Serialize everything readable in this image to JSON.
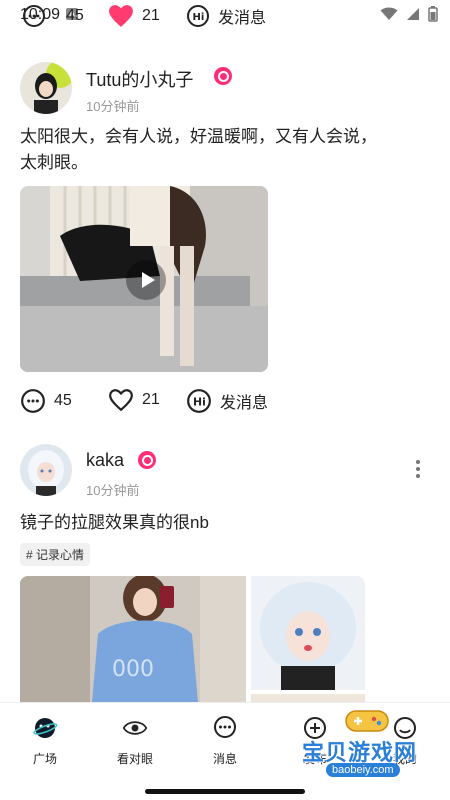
{
  "status_bar": {
    "time": "10:09",
    "indicator": "A"
  },
  "prev_post_actions": {
    "comments": "45",
    "likes": "21",
    "message": "发消息"
  },
  "posts": [
    {
      "username": "Tutu的小丸子",
      "time": "10分钟前",
      "content_line1": "太阳很大，会有人说，好温暖啊，又有人会说，",
      "content_line2": "太刺眼。",
      "comments": "45",
      "likes": "21",
      "message": "发消息"
    },
    {
      "username": "kaka",
      "time": "10分钟前",
      "content": "镜子的拉腿效果真的很nb",
      "tag": "# 记录心情"
    }
  ],
  "bottom_nav": {
    "items": [
      {
        "label": "广场"
      },
      {
        "label": "看对眼"
      },
      {
        "label": "消息"
      },
      {
        "label": "发布"
      },
      {
        "label": "我的"
      }
    ]
  },
  "watermark": {
    "text": "宝贝游戏网",
    "url": "baobeiy.com"
  },
  "colors": {
    "badge": "#ff2d78",
    "heart_filled": "#ff3b6f",
    "secondary_text": "#999999"
  }
}
